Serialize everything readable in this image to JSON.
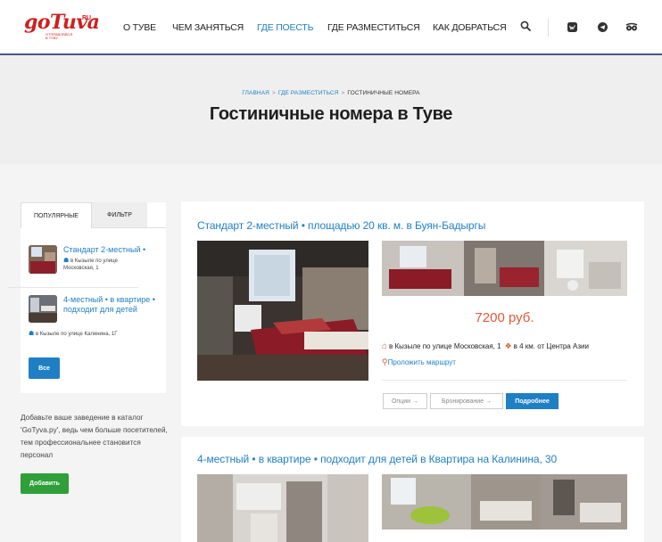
{
  "logo": {
    "main": "goTuva",
    "ru": ".RU",
    "tagline_1": "ОТПРАВЛЯЙСЯ",
    "tagline_2": "В ТУВУ"
  },
  "nav": {
    "items": [
      {
        "label": "О ТУВЕ"
      },
      {
        "label": "ЧЕМ ЗАНЯТЬСЯ"
      },
      {
        "label": "ГДЕ ПОЕСТЬ"
      },
      {
        "label": "ГДЕ РАЗМЕСТИТЬСЯ"
      },
      {
        "label": "КАК ДОБРАТЬСЯ"
      }
    ],
    "active_color": "#1f7fc4"
  },
  "icons": [
    "search-icon",
    "vk-icon",
    "telegram-icon",
    "tripadvisor-icon",
    "home-icon",
    "walker-icon",
    "location-pin-icon"
  ],
  "breadcrumb": {
    "home": "ГЛАВНАЯ",
    "section": "ГДЕ РАЗМЕСТИТЬСЯ",
    "current": "ГОСТИНИЧНЫЕ НОМЕРА",
    "separator": ">"
  },
  "page_title": "Гостиничные номера в Туве",
  "sidebar": {
    "tabs": [
      "ПОПУЛЯРНЫЕ",
      "ФИЛЬТР"
    ],
    "items": [
      {
        "title": "Стандарт 2-местный •",
        "location_1": "в Кызыле по улице",
        "location_2": "Московская, 1"
      },
      {
        "title": "4-местный • в квартире • подходит для детей",
        "location": "в Кызыле по улице Калинина, 1Г"
      }
    ],
    "all_button": "Все"
  },
  "promo": {
    "text": "Добавьте ваше заведение в каталог 'GoTyva.py', ведь чем больше посетителей, тем профессиональнее становится персонал",
    "button": "Добавить"
  },
  "listings": [
    {
      "title": "Стандарт 2-местный  •  площадью 20 кв. м. в Буян-Бадыргы",
      "price": "7200 руб.",
      "location": "в Кызыле по улице Московская, 1",
      "distance": "в 4 км. от Центра Азии",
      "route": "Проложить маршрут",
      "buttons": {
        "options": "Опции →",
        "booking": "Бронирование →",
        "details": "Подробнее"
      }
    },
    {
      "title": "4-местный  • в квартире  • подходит для детей в Квартира на Калинина, 30"
    }
  ],
  "colors": {
    "brand_red": "#cf1f1f",
    "link_blue": "#1f7fc4",
    "price_orange": "#e05a3a",
    "add_green": "#2f9f3a",
    "header_border": "#45568a"
  }
}
